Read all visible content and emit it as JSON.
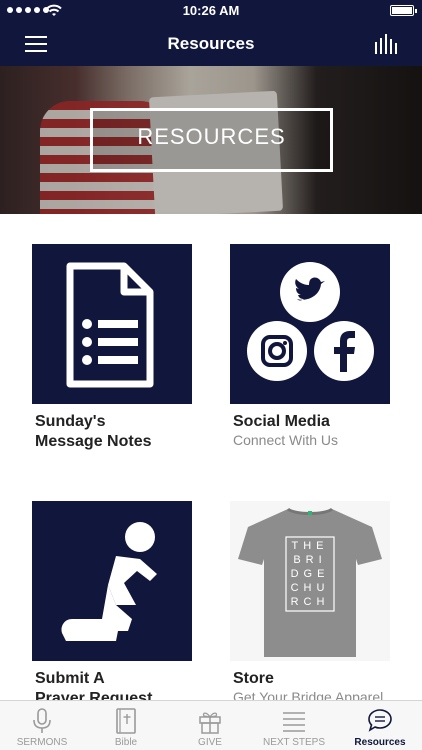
{
  "status_bar": {
    "time": "10:26 AM"
  },
  "nav": {
    "title": "Resources"
  },
  "hero": {
    "title": "RESOURCES"
  },
  "cards": {
    "notes": {
      "title_line1": "Sunday's",
      "title_line2": "Message Notes"
    },
    "social": {
      "title": "Social Media",
      "subtitle": "Connect With Us"
    },
    "prayer": {
      "title_line1": "Submit A",
      "title_line2": "Prayer Request"
    },
    "store": {
      "title": "Store",
      "subtitle": "Get Your Bridge Apparel",
      "shirt_text": [
        "THE",
        "BRI",
        "DGE",
        "CHU",
        "RCH"
      ]
    }
  },
  "tabs": [
    {
      "label": "SERMONS",
      "icon": "microphone-icon"
    },
    {
      "label": "Bible",
      "icon": "bible-icon"
    },
    {
      "label": "GIVE",
      "icon": "gift-icon"
    },
    {
      "label": "NEXT STEPS",
      "icon": "list-icon"
    },
    {
      "label": "Resources",
      "icon": "chat-icon",
      "active": true
    }
  ],
  "colors": {
    "navy": "#11163c",
    "tab_inactive": "#9a9a9a",
    "background": "#ffffff"
  }
}
